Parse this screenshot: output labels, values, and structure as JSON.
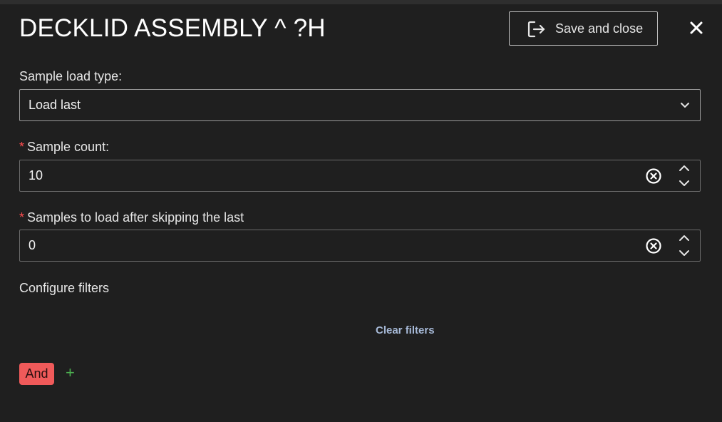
{
  "header": {
    "title": "DECKLID ASSEMBLY ^ ?H",
    "save_label": "Save and close",
    "save_icon": "exit-icon",
    "close_icon": "close-icon"
  },
  "form": {
    "load_type": {
      "label": "Sample load type:",
      "value": "Load last"
    },
    "sample_count": {
      "required_mark": "*",
      "label": "Sample count:",
      "value": "10"
    },
    "skip_count": {
      "required_mark": "*",
      "label": "Samples to load after skipping the last",
      "value": "0"
    }
  },
  "filters": {
    "heading": "Configure filters",
    "clear_label": "Clear filters",
    "operator_label": "And",
    "add_label": "+"
  },
  "colors": {
    "background": "#1f1f1f",
    "required": "#ff4d4f",
    "operator_pill": "#f05a5a",
    "add": "#4caf50",
    "link": "#a7bad8"
  }
}
